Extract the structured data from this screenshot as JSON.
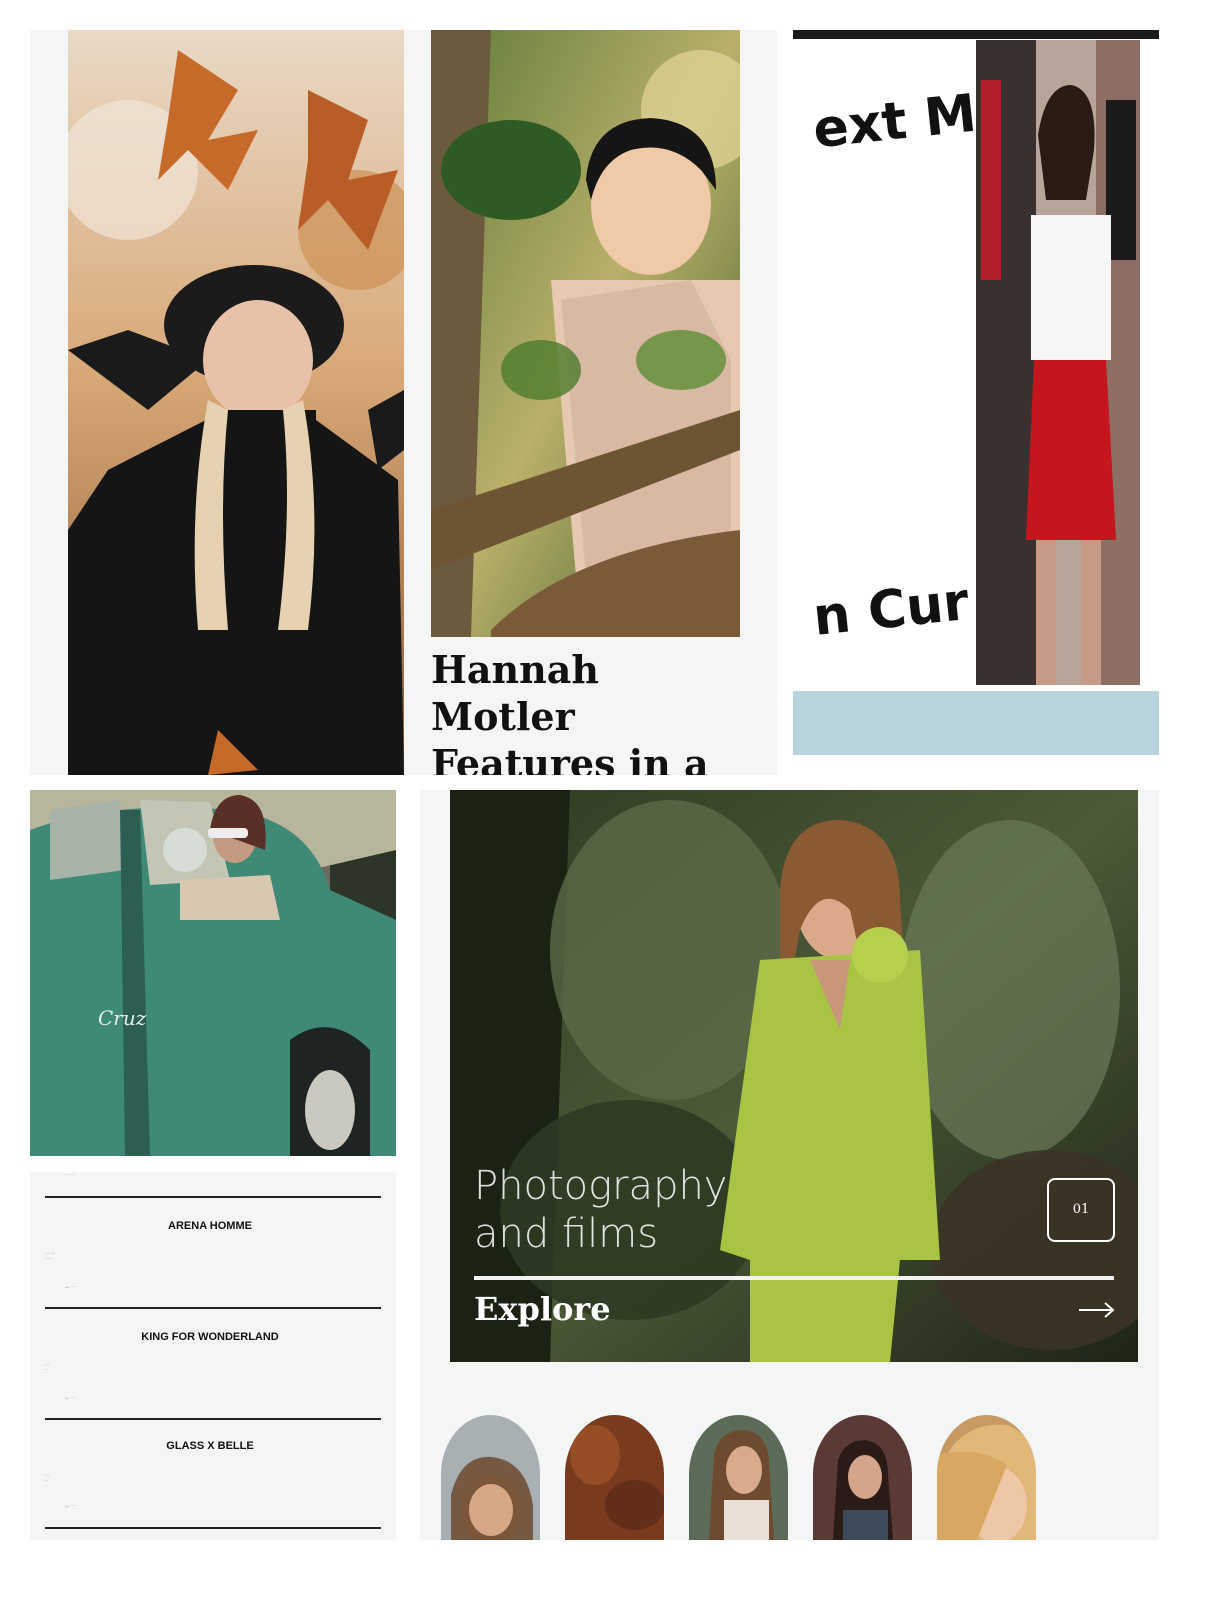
{
  "colors": {
    "page_background": "#ffffff",
    "panel_background": "#f4f5f5",
    "accent_dark": "#1a1a1a",
    "sky_blue": "#b8d3db",
    "car_green": "#3f8a76",
    "suit_green": "#a9c443",
    "skirt_red": "#c4161c"
  },
  "story_card": {
    "headline": "Hannah Motler Features in a fashion story"
  },
  "curved_banner": {
    "top_fragment": "ext M",
    "bottom_fragment": "n Cur"
  },
  "projects_list": {
    "items": [
      {
        "title": "ARENA HOMME"
      },
      {
        "title": "KING FOR WONDERLAND"
      },
      {
        "title": "GLASS X BELLE"
      }
    ]
  },
  "hero": {
    "title_line1": "Photography",
    "title_line2": "and films",
    "counter": "01",
    "cta_label": "Explore",
    "cta_icon": "arrow-right-icon"
  },
  "thumbnails": [
    {
      "name": "portrait-1"
    },
    {
      "name": "texture-1"
    },
    {
      "name": "portrait-2"
    },
    {
      "name": "portrait-3"
    },
    {
      "name": "portrait-4"
    }
  ]
}
